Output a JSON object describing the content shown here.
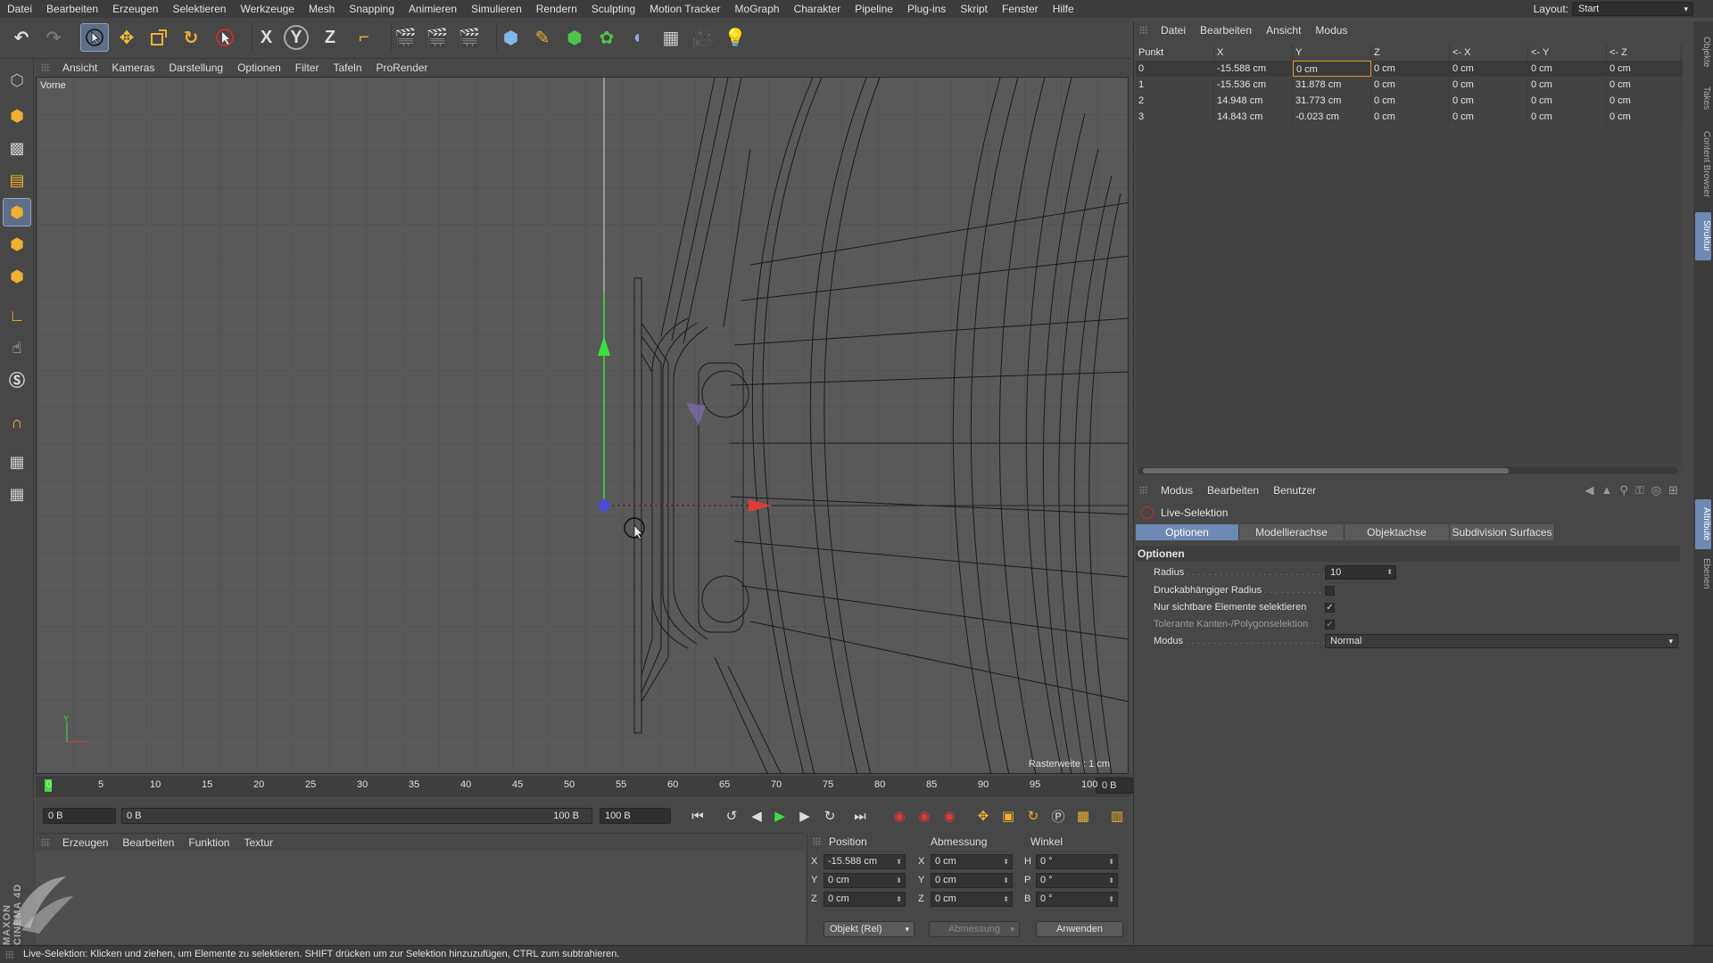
{
  "menubar": {
    "items": [
      "Datei",
      "Bearbeiten",
      "Erzeugen",
      "Selektieren",
      "Werkzeuge",
      "Mesh",
      "Snapping",
      "Animieren",
      "Simulieren",
      "Rendern",
      "Sculpting",
      "Motion Tracker",
      "MoGraph",
      "Charakter",
      "Pipeline",
      "Plug-ins",
      "Skript",
      "Fenster",
      "Hilfe"
    ],
    "layout_label": "Layout:",
    "layout_value": "Start"
  },
  "toolbar": {
    "x_label": "X",
    "y_label": "Y",
    "z_label": "Z"
  },
  "viewport": {
    "menu": [
      "Ansicht",
      "Kameras",
      "Darstellung",
      "Optionen",
      "Filter",
      "Tafeln",
      "ProRender"
    ],
    "camera_name": "Vorne",
    "grid_info": "Rasterweite : 1 cm",
    "axis_y": "Y"
  },
  "timeline": {
    "ticks": [
      "0",
      "5",
      "10",
      "15",
      "20",
      "25",
      "30",
      "35",
      "40",
      "45",
      "50",
      "55",
      "60",
      "65",
      "70",
      "75",
      "80",
      "85",
      "90",
      "95",
      "100"
    ],
    "current_frame": "0 B",
    "start_field": "0 B",
    "range_start": "0 B",
    "range_end": "100 B",
    "end_field": "100 B"
  },
  "material_manager": {
    "menu": [
      "Erzeugen",
      "Bearbeiten",
      "Funktion",
      "Textur"
    ]
  },
  "coordinates": {
    "headers": {
      "position": "Position",
      "size": "Abmessung",
      "rotation": "Winkel"
    },
    "rows": [
      {
        "axis": "X",
        "pos": "-15.588 cm",
        "size_axis": "X",
        "size": "0 cm",
        "rot_axis": "H",
        "rot": "0 °"
      },
      {
        "axis": "Y",
        "pos": "0 cm",
        "size_axis": "Y",
        "size": "0 cm",
        "rot_axis": "P",
        "rot": "0 °"
      },
      {
        "axis": "Z",
        "pos": "0 cm",
        "size_axis": "Z",
        "size": "0 cm",
        "rot_axis": "B",
        "rot": "0 °"
      }
    ],
    "mode": "Objekt (Rel)",
    "size_mode": "Abmessung",
    "apply": "Anwenden"
  },
  "branding": {
    "logo_text": "MAXON CINEMA 4D"
  },
  "status": "Live-Selektion: Klicken und ziehen, um Elemente zu selektieren. SHIFT drücken um zur Selektion hinzuzufügen, CTRL zum subtrahieren.",
  "structure_panel": {
    "menu": [
      "Datei",
      "Bearbeiten",
      "Ansicht",
      "Modus"
    ],
    "columns": [
      "Punkt",
      "X",
      "Y",
      "Z",
      "<- X",
      "<- Y",
      "<- Z"
    ],
    "rows": [
      [
        "0",
        "-15.588 cm",
        "0 cm",
        "0 cm",
        "0 cm",
        "0 cm",
        "0 cm"
      ],
      [
        "1",
        "-15.536 cm",
        "31.878 cm",
        "0 cm",
        "0 cm",
        "0 cm",
        "0 cm"
      ],
      [
        "2",
        "14.948 cm",
        "31.773 cm",
        "0 cm",
        "0 cm",
        "0 cm",
        "0 cm"
      ],
      [
        "3",
        "14.843 cm",
        "-0.023 cm",
        "0 cm",
        "0 cm",
        "0 cm",
        "0 cm"
      ]
    ]
  },
  "attributes": {
    "menu": [
      "Modus",
      "Bearbeiten",
      "Benutzer"
    ],
    "tool_name": "Live-Selektion",
    "tabs": [
      "Optionen",
      "Modellierachse",
      "Objektachse",
      "Subdivision Surfaces"
    ],
    "section": "Optionen",
    "radius_label": "Radius",
    "radius_value": "10",
    "pressure_label": "Druckabhängiger Radius",
    "visible_only_label": "Nur sichtbare Elemente selektieren",
    "tolerant_label": "Tolerante Kanten-/Polygonselektion",
    "mode_label": "Modus",
    "mode_value": "Normal",
    "checkmark": "✓"
  },
  "side_tabs": [
    "Objekte",
    "Takes",
    "Content Browser",
    "Struktur",
    "Attribute",
    "Ebenen"
  ],
  "colors": {
    "accent": "#6e89b3",
    "selection": "#e29a2c",
    "axis_y": "#3ee03e",
    "axis_x": "#e03a3a",
    "axis_z": "#3a3ae0"
  }
}
